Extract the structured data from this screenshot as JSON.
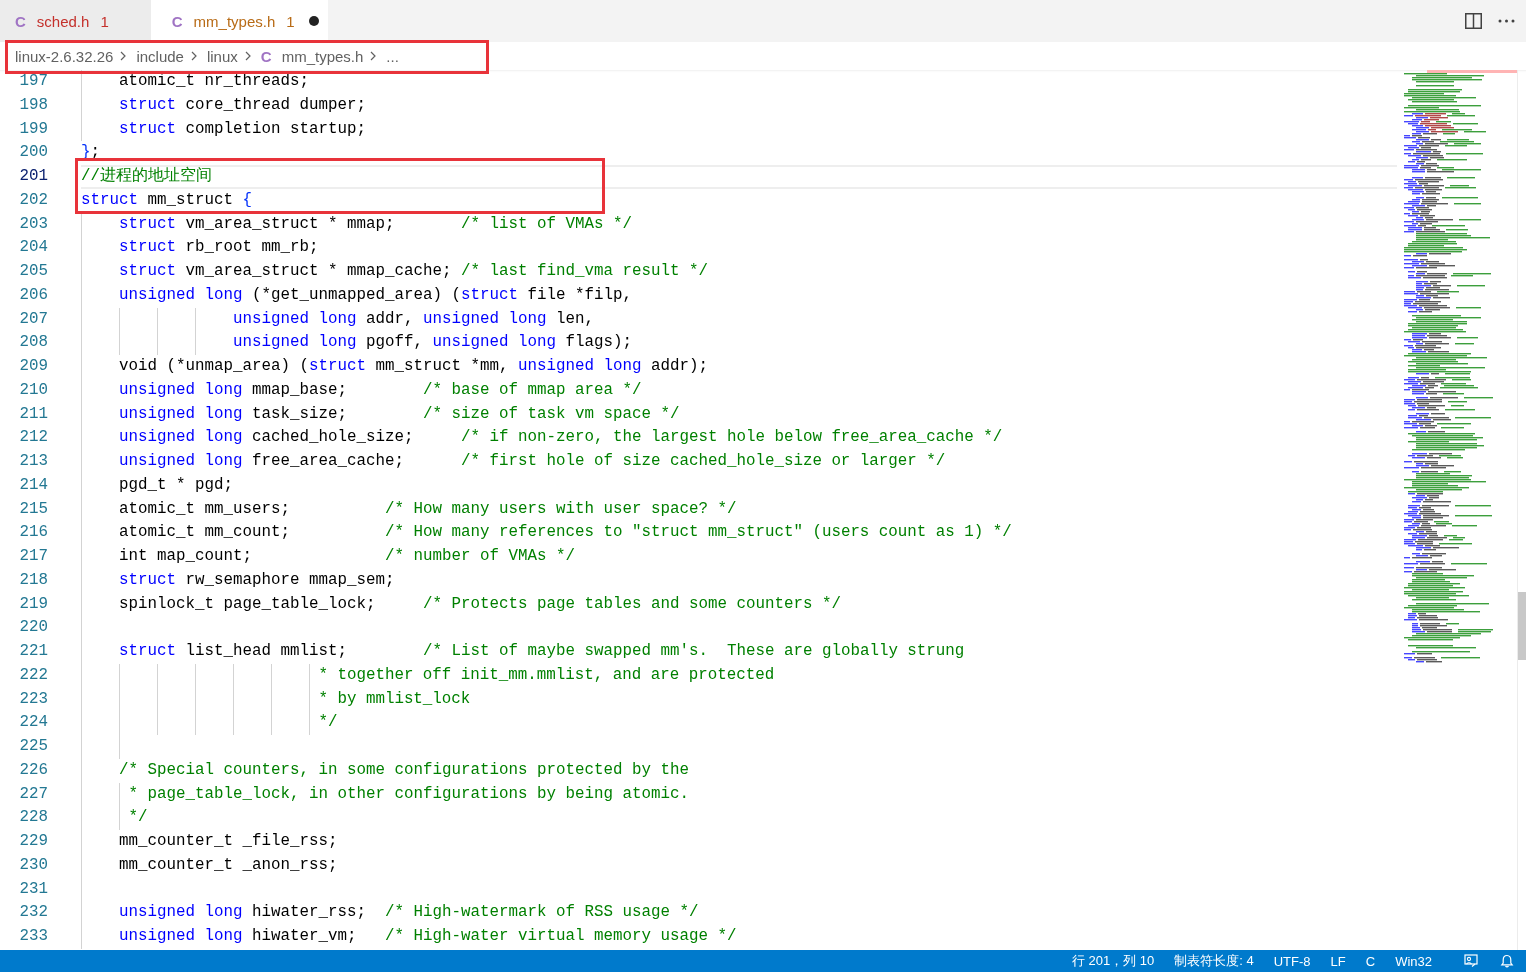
{
  "tabs": [
    {
      "icon": "C",
      "label": "sched.h",
      "problems": "1",
      "color": "#c4302b",
      "modified": false,
      "selected": false
    },
    {
      "icon": "C",
      "label": "mm_types.h",
      "problems": "1",
      "color": "#b86b16",
      "modified": true,
      "selected": true
    }
  ],
  "breadcrumb": {
    "boxed": true,
    "items": [
      {
        "label": "linux-2.6.32.26"
      },
      {
        "label": "include"
      },
      {
        "label": "linux"
      },
      {
        "icon": "C",
        "label": "mm_types.h"
      },
      {
        "label": "..."
      }
    ]
  },
  "editor": {
    "lines": [
      {
        "number": "197",
        "current": false,
        "boxed": false,
        "tokens": [
          {
            "kind": "plain",
            "text": "\tatomic_t nr_threads;"
          }
        ]
      },
      {
        "number": "198",
        "current": false,
        "boxed": false,
        "tokens": [
          {
            "kind": "keyword",
            "text": "\tstruct"
          },
          {
            "kind": "plain",
            "text": " core_thread dumper;"
          }
        ]
      },
      {
        "number": "199",
        "current": false,
        "boxed": false,
        "tokens": [
          {
            "kind": "keyword",
            "text": "\tstruct"
          },
          {
            "kind": "plain",
            "text": " completion startup;"
          }
        ]
      },
      {
        "number": "200",
        "current": false,
        "boxed": false,
        "tokens": [
          {
            "kind": "bracket",
            "text": "}"
          },
          {
            "kind": "plain",
            "text": ";"
          }
        ]
      },
      {
        "number": "201",
        "current": true,
        "boxed": true,
        "tokens": [
          {
            "kind": "comment",
            "text": "//进程的地址空间"
          }
        ]
      },
      {
        "number": "202",
        "current": false,
        "boxed": true,
        "tokens": [
          {
            "kind": "keyword",
            "text": "struct"
          },
          {
            "kind": "plain",
            "text": " mm_struct "
          },
          {
            "kind": "bracket",
            "text": "{"
          }
        ]
      },
      {
        "number": "203",
        "current": false,
        "boxed": false,
        "tokens": [
          {
            "kind": "keyword",
            "text": "\tstruct"
          },
          {
            "kind": "plain",
            "text": " vm_area_struct * mmap;\t\t"
          },
          {
            "kind": "comment",
            "text": "/* list of VMAs */"
          }
        ]
      },
      {
        "number": "204",
        "current": false,
        "boxed": false,
        "tokens": [
          {
            "kind": "keyword",
            "text": "\tstruct"
          },
          {
            "kind": "plain",
            "text": " rb_root mm_rb;"
          }
        ]
      },
      {
        "number": "205",
        "current": false,
        "boxed": false,
        "tokens": [
          {
            "kind": "keyword",
            "text": "\tstruct"
          },
          {
            "kind": "plain",
            "text": " vm_area_struct * mmap_cache; "
          },
          {
            "kind": "comment",
            "text": "/* last find_vma result */"
          }
        ]
      },
      {
        "number": "206",
        "current": false,
        "boxed": false,
        "tokens": [
          {
            "kind": "keyword",
            "text": "\tunsigned long"
          },
          {
            "kind": "plain",
            "text": " (*get_unmapped_area) ("
          },
          {
            "kind": "keyword",
            "text": "struct"
          },
          {
            "kind": "plain",
            "text": " file *filp,"
          }
        ]
      },
      {
        "number": "207",
        "current": false,
        "boxed": false,
        "tokens": [
          {
            "kind": "keyword",
            "text": "\t\t\t\tunsigned long"
          },
          {
            "kind": "plain",
            "text": " addr, "
          },
          {
            "kind": "keyword",
            "text": "unsigned long"
          },
          {
            "kind": "plain",
            "text": " len,"
          }
        ]
      },
      {
        "number": "208",
        "current": false,
        "boxed": false,
        "tokens": [
          {
            "kind": "keyword",
            "text": "\t\t\t\tunsigned long"
          },
          {
            "kind": "plain",
            "text": " pgoff, "
          },
          {
            "kind": "keyword",
            "text": "unsigned long"
          },
          {
            "kind": "plain",
            "text": " flags);"
          }
        ]
      },
      {
        "number": "209",
        "current": false,
        "boxed": false,
        "tokens": [
          {
            "kind": "plain",
            "text": "\tvoid (*unmap_area) ("
          },
          {
            "kind": "keyword",
            "text": "struct"
          },
          {
            "kind": "plain",
            "text": " mm_struct *mm, "
          },
          {
            "kind": "keyword",
            "text": "unsigned long"
          },
          {
            "kind": "plain",
            "text": " addr);"
          }
        ]
      },
      {
        "number": "210",
        "current": false,
        "boxed": false,
        "tokens": [
          {
            "kind": "keyword",
            "text": "\tunsigned long"
          },
          {
            "kind": "plain",
            "text": " mmap_base;\t\t"
          },
          {
            "kind": "comment",
            "text": "/* base of mmap area */"
          }
        ]
      },
      {
        "number": "211",
        "current": false,
        "boxed": false,
        "tokens": [
          {
            "kind": "keyword",
            "text": "\tunsigned long"
          },
          {
            "kind": "plain",
            "text": " task_size;\t\t"
          },
          {
            "kind": "comment",
            "text": "/* size of task vm space */"
          }
        ]
      },
      {
        "number": "212",
        "current": false,
        "boxed": false,
        "tokens": [
          {
            "kind": "keyword",
            "text": "\tunsigned long"
          },
          {
            "kind": "plain",
            "text": " cached_hole_size;\t\t"
          },
          {
            "kind": "comment",
            "text": "/* if non-zero, the largest hole below free_area_cache */"
          }
        ]
      },
      {
        "number": "213",
        "current": false,
        "boxed": false,
        "tokens": [
          {
            "kind": "keyword",
            "text": "\tunsigned long"
          },
          {
            "kind": "plain",
            "text": " free_area_cache;\t\t"
          },
          {
            "kind": "comment",
            "text": "/* first hole of size cached_hole_size or larger */"
          }
        ]
      },
      {
        "number": "214",
        "current": false,
        "boxed": false,
        "tokens": [
          {
            "kind": "plain",
            "text": "\tpgd_t * pgd;"
          }
        ]
      },
      {
        "number": "215",
        "current": false,
        "boxed": false,
        "tokens": [
          {
            "kind": "plain",
            "text": "\tatomic_t mm_users;\t\t\t"
          },
          {
            "kind": "comment",
            "text": "/* How many users with user space? */"
          }
        ]
      },
      {
        "number": "216",
        "current": false,
        "boxed": false,
        "tokens": [
          {
            "kind": "plain",
            "text": "\tatomic_t mm_count;\t\t\t"
          },
          {
            "kind": "comment",
            "text": "/* How many references to \"struct mm_struct\" (users count as 1) */"
          }
        ]
      },
      {
        "number": "217",
        "current": false,
        "boxed": false,
        "tokens": [
          {
            "kind": "plain",
            "text": "\tint map_count;\t\t\t\t"
          },
          {
            "kind": "comment",
            "text": "/* number of VMAs */"
          }
        ]
      },
      {
        "number": "218",
        "current": false,
        "boxed": false,
        "tokens": [
          {
            "kind": "keyword",
            "text": "\tstruct"
          },
          {
            "kind": "plain",
            "text": " rw_semaphore mmap_sem;"
          }
        ]
      },
      {
        "number": "219",
        "current": false,
        "boxed": false,
        "tokens": [
          {
            "kind": "plain",
            "text": "\tspinlock_t page_table_lock;\t\t"
          },
          {
            "kind": "comment",
            "text": "/* Protects page tables and some counters */"
          }
        ]
      },
      {
        "number": "220",
        "current": false,
        "boxed": false
      },
      {
        "number": "221",
        "current": false,
        "boxed": false,
        "tokens": [
          {
            "kind": "keyword",
            "text": "\tstruct"
          },
          {
            "kind": "plain",
            "text": " list_head mmlist;\t\t"
          },
          {
            "kind": "comment",
            "text": "/* List of maybe swapped mm's.  These are globally strung"
          }
        ]
      },
      {
        "number": "222",
        "current": false,
        "boxed": false,
        "tokens": [
          {
            "kind": "comment",
            "text": "\t\t\t\t\t\t * together off init_mm.mmlist, and are protected"
          }
        ]
      },
      {
        "number": "223",
        "current": false,
        "boxed": false,
        "tokens": [
          {
            "kind": "comment",
            "text": "\t\t\t\t\t\t * by mmlist_lock"
          }
        ]
      },
      {
        "number": "224",
        "current": false,
        "boxed": false,
        "tokens": [
          {
            "kind": "comment",
            "text": "\t\t\t\t\t\t */"
          }
        ]
      },
      {
        "number": "225",
        "current": false,
        "boxed": false
      },
      {
        "number": "226",
        "current": false,
        "boxed": false,
        "tokens": [
          {
            "kind": "comment",
            "text": "\t/* Special counters, in some configurations protected by the"
          }
        ]
      },
      {
        "number": "227",
        "current": false,
        "boxed": false,
        "tokens": [
          {
            "kind": "comment",
            "text": "\t * page_table_lock, in other configurations by being atomic."
          }
        ]
      },
      {
        "number": "228",
        "current": false,
        "boxed": false,
        "tokens": [
          {
            "kind": "comment",
            "text": "\t */"
          }
        ]
      },
      {
        "number": "229",
        "current": false,
        "boxed": false,
        "tokens": [
          {
            "kind": "plain",
            "text": "\tmm_counter_t _file_rss;"
          }
        ]
      },
      {
        "number": "230",
        "current": false,
        "boxed": false,
        "tokens": [
          {
            "kind": "plain",
            "text": "\tmm_counter_t _anon_rss;"
          }
        ]
      },
      {
        "number": "231",
        "current": false,
        "boxed": false
      },
      {
        "number": "232",
        "current": false,
        "boxed": false,
        "tokens": [
          {
            "kind": "keyword",
            "text": "\tunsigned long"
          },
          {
            "kind": "plain",
            "text": " hiwater_rss;\t"
          },
          {
            "kind": "comment",
            "text": "/* High-watermark of RSS usage */"
          }
        ]
      },
      {
        "number": "233",
        "current": false,
        "boxed": false,
        "tokens": [
          {
            "kind": "keyword",
            "text": "\tunsigned long"
          },
          {
            "kind": "plain",
            "text": " hiwater_vm;\t"
          },
          {
            "kind": "comment",
            "text": "/* High-water virtual memory usage */"
          }
        ]
      }
    ]
  },
  "status_bar": {
    "items": [
      "行 201，列 10",
      "制表符长度: 4",
      "UTF-8",
      "LF",
      "C",
      "Win32"
    ]
  }
}
